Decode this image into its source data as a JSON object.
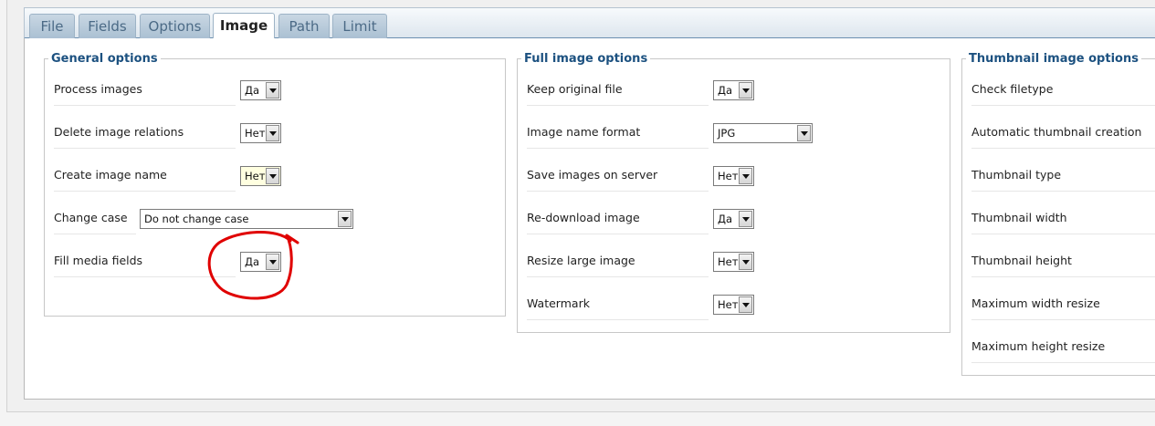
{
  "tabs": [
    {
      "label": "File"
    },
    {
      "label": "Fields"
    },
    {
      "label": "Options"
    },
    {
      "label": "Image"
    },
    {
      "label": "Path"
    },
    {
      "label": "Limit"
    }
  ],
  "active_tab": "Image",
  "general": {
    "legend": "General options",
    "process_images": {
      "label": "Process images",
      "value": "Да"
    },
    "delete_relations": {
      "label": "Delete image relations",
      "value": "Нет"
    },
    "create_name": {
      "label": "Create image name",
      "value": "Нет"
    },
    "change_case": {
      "label": "Change case",
      "value": "Do not change case"
    },
    "fill_media": {
      "label": "Fill media fields",
      "value": "Да"
    }
  },
  "full": {
    "legend": "Full image options",
    "keep_original": {
      "label": "Keep original file",
      "value": "Да"
    },
    "name_format": {
      "label": "Image name format",
      "value": "JPG"
    },
    "save_on_server": {
      "label": "Save images on server",
      "value": "Нет"
    },
    "redownload": {
      "label": "Re-download image",
      "value": "Да"
    },
    "resize_large": {
      "label": "Resize large image",
      "value": "Нет"
    },
    "watermark": {
      "label": "Watermark",
      "value": "Нет"
    }
  },
  "thumb": {
    "legend": "Thumbnail image options",
    "labels": [
      "Check filetype",
      "Automatic thumbnail creation",
      "Thumbnail type",
      "Thumbnail width",
      "Thumbnail height",
      "Maximum width resize",
      "Maximum height resize"
    ]
  },
  "colors": {
    "annotation": "#e00000",
    "legend": "#1c5180",
    "tab_accent": "#6b8fb0"
  }
}
